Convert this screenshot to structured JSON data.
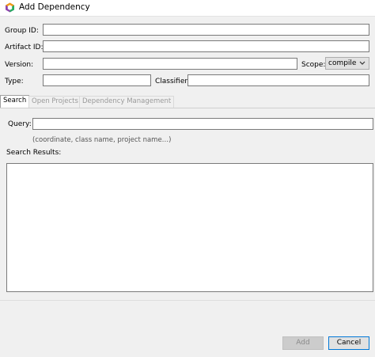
{
  "window": {
    "title": "Add Dependency"
  },
  "form": {
    "group_id_label": "Group ID:",
    "group_id_value": "",
    "artifact_id_label": "Artifact ID:",
    "artifact_id_value": "",
    "version_label": "Version:",
    "version_value": "",
    "scope_label": "Scope:",
    "scope_value": "compile",
    "type_label": "Type:",
    "type_value": "",
    "classifier_label": "Classifier:",
    "classifier_value": ""
  },
  "tabs": [
    {
      "label": "Search",
      "active": true
    },
    {
      "label": "Open Projects",
      "active": false
    },
    {
      "label": "Dependency Management",
      "active": false
    }
  ],
  "search": {
    "query_label": "Query:",
    "query_value": "",
    "hint": "(coordinate, class name, project name…)",
    "results_label": "Search Results:"
  },
  "buttons": {
    "add": "Add",
    "cancel": "Cancel"
  },
  "colors": {
    "accent": "#0078d7",
    "icon_orange": "#f39c12",
    "icon_purple": "#8e44ad",
    "icon_green": "#27ae60"
  }
}
